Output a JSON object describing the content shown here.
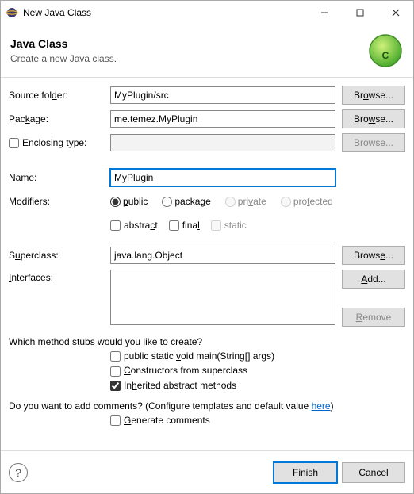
{
  "titlebar": {
    "title": "New Java Class"
  },
  "header": {
    "title": "Java Class",
    "subtitle": "Create a new Java class."
  },
  "labels": {
    "source_folder_pre": "Source fol",
    "source_folder_ul": "d",
    "source_folder_post": "er:",
    "package_pre": "Pac",
    "package_ul": "k",
    "package_post": "age:",
    "enclosing_pre": "Enclosing t",
    "enclosing_ul": "y",
    "enclosing_post": "pe:",
    "name_pre": "Na",
    "name_ul": "m",
    "name_post": "e:",
    "modifiers": "Modifiers:",
    "superclass_pre": "S",
    "superclass_ul": "u",
    "superclass_post": "perclass:",
    "interfaces_pre": "",
    "interfaces_ul": "I",
    "interfaces_post": "nterfaces:"
  },
  "fields": {
    "source_folder": "MyPlugin/src",
    "package": "me.temez.MyPlugin",
    "enclosing": "",
    "name": "MyPlugin",
    "superclass": "java.lang.Object"
  },
  "buttons": {
    "browse_o_pre": "Br",
    "browse_o_ul": "o",
    "browse_o_post": "wse...",
    "browse_w_pre": "Bro",
    "browse_w_ul": "w",
    "browse_w_post": "se...",
    "browse_plain": "Browse...",
    "browse_e_pre": "Brows",
    "browse_e_ul": "e",
    "browse_e_post": "...",
    "add_pre": "",
    "add_ul": "A",
    "add_post": "dd...",
    "remove_pre": "",
    "remove_ul": "R",
    "remove_post": "emove",
    "finish_pre": "",
    "finish_ul": "F",
    "finish_post": "inish",
    "cancel": "Cancel"
  },
  "modifiers": {
    "public_ul": "p",
    "public_post": "ublic",
    "package_pre": "packa",
    "package_ul": "g",
    "package_post": "e",
    "private_pre": "pri",
    "private_ul": "v",
    "private_post": "ate",
    "protected_pre": "pro",
    "protected_ul": "t",
    "protected_post": "ected",
    "abstract_pre": "abstra",
    "abstract_ul": "c",
    "abstract_post": "t",
    "final_pre": "fina",
    "final_ul": "l",
    "static": "static"
  },
  "stubs": {
    "question": "Which method stubs would you like to create?",
    "main_pre": "public static ",
    "main_ul": "v",
    "main_post": "oid main(String[] args)",
    "constructors_pre": "",
    "constructors_ul": "C",
    "constructors_post": "onstructors from superclass",
    "inherited_pre": "In",
    "inherited_ul": "h",
    "inherited_post": "erited abstract methods"
  },
  "comments": {
    "question_pre": "Do you want to add comments? (Configure templates and default value ",
    "link": "here",
    "question_post": ")",
    "generate_ul": "G",
    "generate_post": "enerate comments"
  }
}
